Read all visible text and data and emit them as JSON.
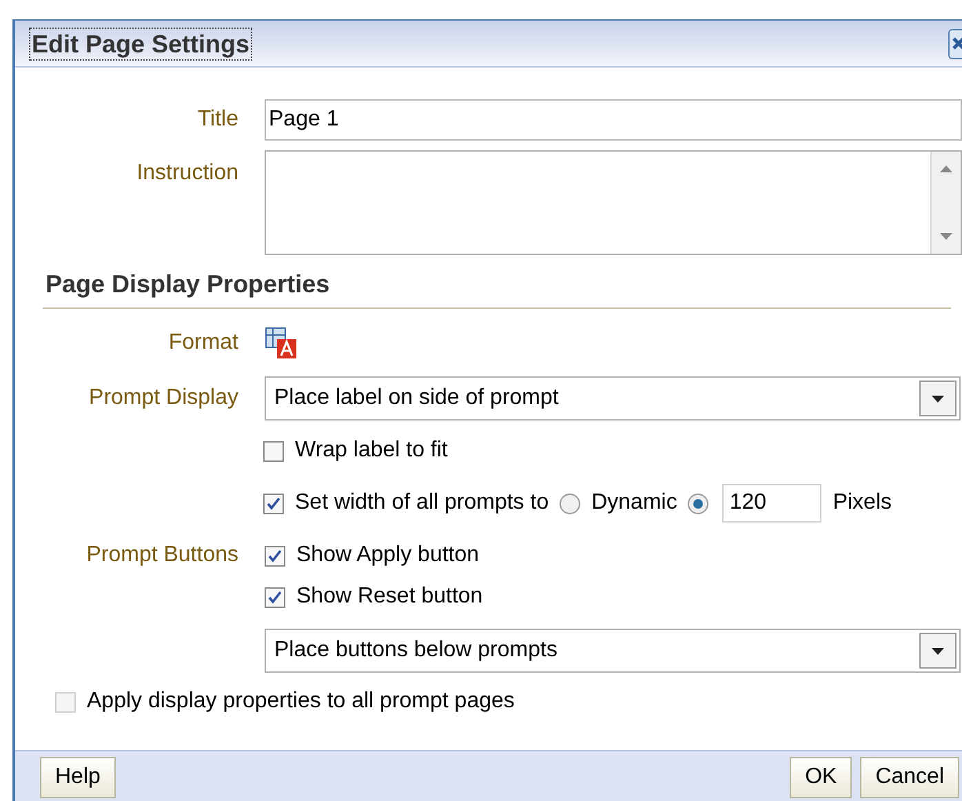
{
  "dialog": {
    "title": "Edit Page Settings"
  },
  "title_field": {
    "label": "Title",
    "value": "Page 1"
  },
  "instruction_field": {
    "label": "Instruction"
  },
  "section": {
    "heading": "Page Display Properties"
  },
  "format": {
    "label": "Format"
  },
  "prompt_display": {
    "label": "Prompt Display",
    "value": "Place label on side of prompt"
  },
  "wrap": {
    "label": "Wrap label to fit",
    "checked": false
  },
  "set_width": {
    "label": "Set width of all prompts to",
    "checked": true,
    "options": [
      {
        "label": "Dynamic",
        "selected": false
      },
      {
        "selected": true
      }
    ],
    "value": "120",
    "unit": "Pixels"
  },
  "prompt_buttons": {
    "label": "Prompt Buttons",
    "checks": [
      {
        "label": "Show Apply button",
        "checked": true
      },
      {
        "label": "Show Reset button",
        "checked": true
      }
    ],
    "placement": "Place buttons below prompts"
  },
  "apply_all": {
    "label": "Apply display properties to all prompt pages",
    "checked": false,
    "disabled": true
  },
  "footer": {
    "left_buttons": [
      "Help"
    ],
    "right_buttons": [
      "OK",
      "Cancel"
    ]
  }
}
